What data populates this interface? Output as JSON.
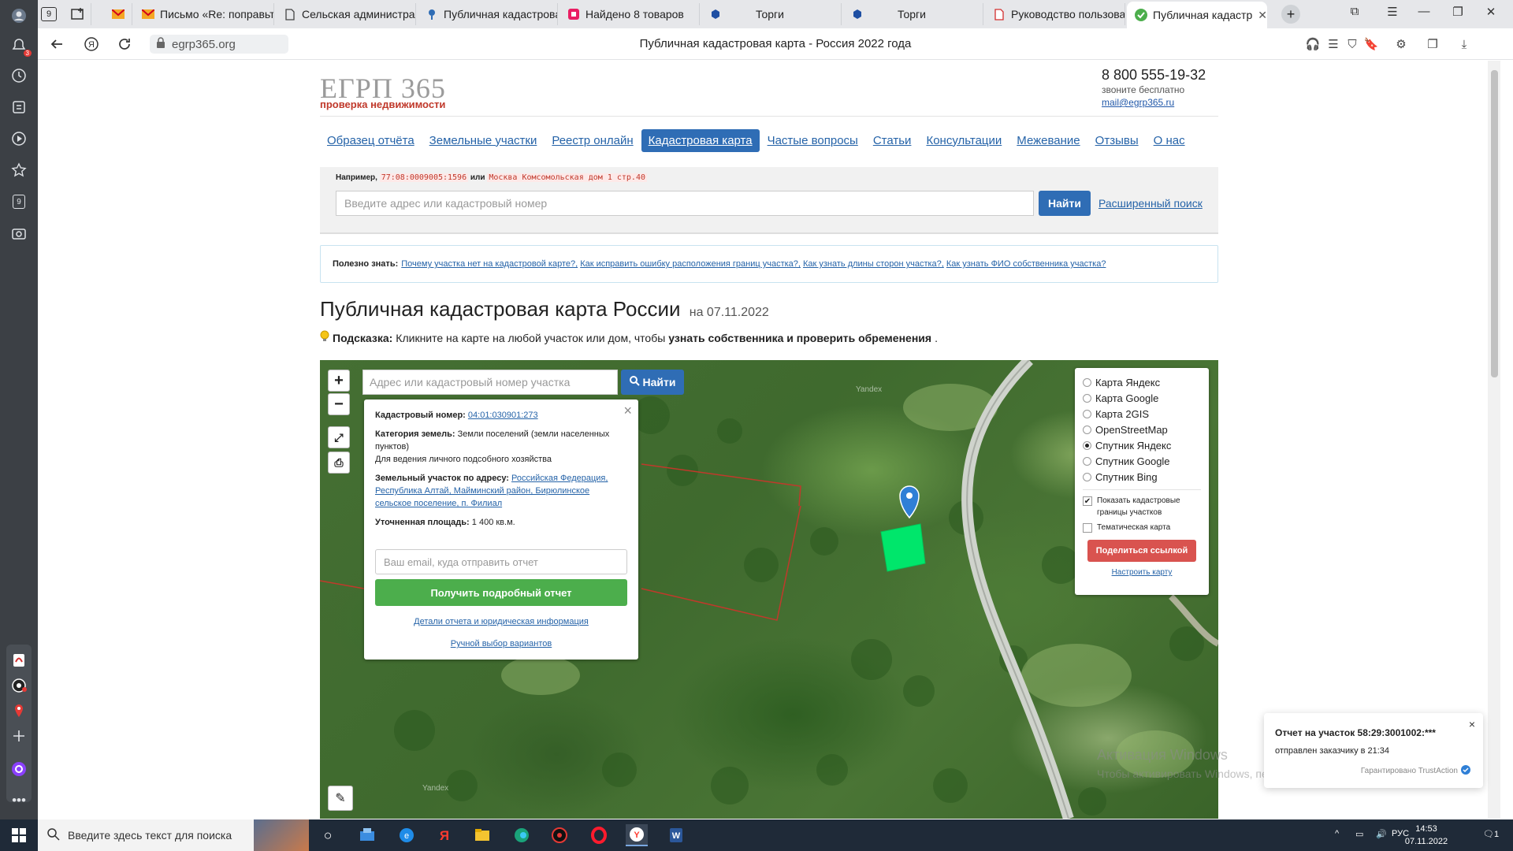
{
  "browser": {
    "tabs": [
      {
        "label": "",
        "icon": "yandex-home-icon"
      },
      {
        "label": "",
        "icon": "new-tab-icon"
      },
      {
        "label": "",
        "icon": "mail-icon"
      },
      {
        "label": "Письмо «Re: поправьте",
        "icon": "mail-icon"
      },
      {
        "label": "Сельская администрац",
        "icon": "page-icon"
      },
      {
        "label": "Публичная кадастрова",
        "icon": "pin-icon"
      },
      {
        "label": "Найдено 8 товаров",
        "icon": "shop-icon"
      },
      {
        "label": "Торги",
        "icon": "emblem-icon"
      },
      {
        "label": "Торги",
        "icon": "emblem-icon"
      },
      {
        "label": "Руководство пользова",
        "icon": "pdf-icon"
      },
      {
        "label": "Публичная кадастр",
        "icon": "check-icon",
        "active": true
      }
    ],
    "tab_counter": "9",
    "address": "egrp365.org",
    "page_title": "Публичная кадастровая карта - Россия 2022 года",
    "notif_badge": "3",
    "sidebar_counter": "9"
  },
  "header": {
    "logo": "ЕГРП 365",
    "logo_sub": "проверка недвижимости",
    "phone": "8 800 555-19-32",
    "phone_sub": "звоните бесплатно",
    "email": "mail@egrp365.ru"
  },
  "menu": [
    {
      "label": "Образец отчёта"
    },
    {
      "label": "Земельные участки"
    },
    {
      "label": "Реестр онлайн"
    },
    {
      "label": "Кадастровая карта",
      "active": true
    },
    {
      "label": "Частые вопросы"
    },
    {
      "label": "Статьи"
    },
    {
      "label": "Консультации"
    },
    {
      "label": "Межевание"
    },
    {
      "label": "Отзывы"
    },
    {
      "label": "О нас"
    }
  ],
  "search": {
    "example_prefix": "Например,",
    "example_code": "77:08:0009005:1596",
    "example_or": "или",
    "example_address": "Москва Комсомольская дом 1 стр.40",
    "placeholder": "Введите адрес или кадастровый номер",
    "button": "Найти",
    "advanced": "Расширенный поиск"
  },
  "tips": {
    "label": "Полезно знать:",
    "links": [
      "Почему участка нет на кадастровой карте?,",
      "Как исправить ошибку расположения границ участка?,",
      "Как узнать длины сторон участка?,",
      "Как узнать ФИО собственника участка?"
    ]
  },
  "title": {
    "main": "Публичная кадастровая карта России",
    "date": "на 07.11.2022"
  },
  "hint": {
    "label": "Подсказка:",
    "text": "Кликните на карте на любой участок или дом, чтобы",
    "bold": "узнать собственника и проверить обременения",
    "end": "."
  },
  "map": {
    "search_placeholder": "Адрес или кадастровый номер участка",
    "search_button": "Найти",
    "zoom_in": "+",
    "zoom_out": "−",
    "watermark": "Yandex",
    "popup": {
      "cadastral_label": "Кадастровый номер:",
      "cadastral_value": "04:01:030901:273",
      "category_label": "Категория земель:",
      "category_value": "Земли поселений (земли населенных пунктов)",
      "usage": "Для ведения личного подсобного хозяйства",
      "address_label": "Земельный участок по адресу:",
      "address_value": "Российская Федерация, Республика Алтай, Майминский район, Бирюлинское сельское поселение, п. Филиал",
      "area_label": "Уточненная площадь:",
      "area_value": "1 400 кв.м.",
      "email_placeholder": "Ваш email, куда отправить отчет",
      "get_report": "Получить подробный отчет",
      "details_link": "Детали отчета и юридическая информация",
      "manual_link": "Ручной выбор вариантов"
    },
    "layers": {
      "options": [
        {
          "label": "Карта Яндекс",
          "selected": false
        },
        {
          "label": "Карта Google",
          "selected": false
        },
        {
          "label": "Карта 2GIS",
          "selected": false
        },
        {
          "label": "OpenStreetMap",
          "selected": false
        },
        {
          "label": "Спутник Яндекс",
          "selected": true
        },
        {
          "label": "Спутник Google",
          "selected": false
        },
        {
          "label": "Спутник Bing",
          "selected": false
        }
      ],
      "show_borders": "Показать кадастровые границы участков",
      "show_borders_checked": true,
      "thematic": "Тематическая карта",
      "thematic_checked": false,
      "share": "Поделиться ссылкой",
      "configure": "Настроить карту"
    }
  },
  "toast": {
    "title": "Отчет на участок 58:29:3001002:***",
    "subtitle": "отправлен заказчику в 21:34",
    "brand": "Гарантировано TrustAction",
    "close": "×"
  },
  "windows_activation": {
    "title": "Активация Windows",
    "subtitle": "Чтобы активировать Windows, перейдите в раздел \"Параметры\"."
  },
  "taskbar": {
    "search_placeholder": "Введите здесь текст для поиска",
    "lang": "РУС",
    "time": "14:53",
    "date": "07.11.2022",
    "notif_count": "1"
  },
  "colors": {
    "link": "#2563a8",
    "primary": "#2f6db5",
    "success": "#4cae4c",
    "danger": "#d9534f",
    "parcel_fill": "#00e66b",
    "parcel_border": "#c0392b"
  }
}
